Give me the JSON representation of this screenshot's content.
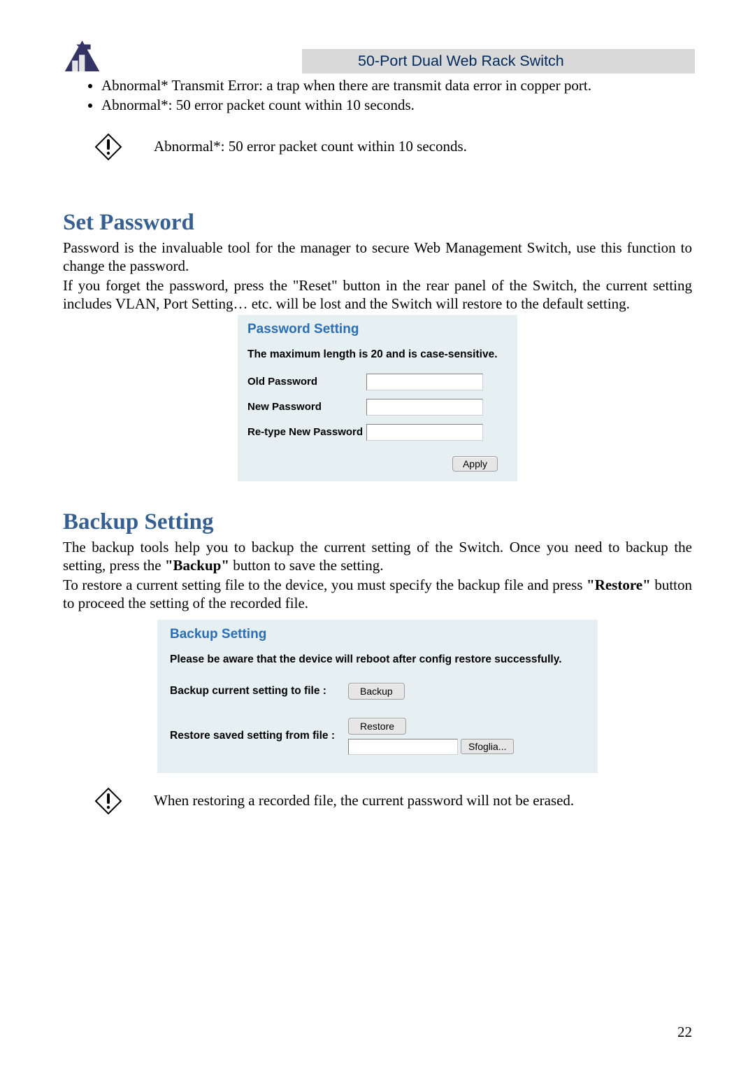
{
  "header": {
    "product_title": "50-Port Dual Web Rack Switch"
  },
  "top_bullets": [
    "Abnormal* Transmit Error: a trap when there are transmit data error in copper port.",
    "Abnormal*: 50 error packet count within 10 seconds."
  ],
  "top_note": "Abnormal*: 50 error packet count within 10 seconds.",
  "set_password": {
    "heading": "Set Password",
    "para1": "Password is the invaluable tool for the manager to secure Web Management Switch, use this function to change the password.",
    "para2": "If you forget the password, press the \"Reset\" button in the rear panel of the Switch, the current setting includes VLAN, Port Setting… etc. will be lost and the Switch will restore to the default setting.",
    "panel_title": "Password Setting",
    "subtitle": "The maximum length is 20 and is case-sensitive.",
    "label_old": "Old Password",
    "label_new": "New Password",
    "label_retype": "Re-type New Password",
    "apply": "Apply"
  },
  "backup": {
    "heading": "Backup Setting",
    "para1_a": "The backup tools help you to backup the current setting of the Switch. Once you need to backup the setting, press the ",
    "para1_b": "\"Backup\"",
    "para1_c": " button to save the setting.",
    "para2_a": "To restore a current setting file to the device, you must specify the backup file and press ",
    "para2_b": "\"Restore\"",
    "para2_c": " button to proceed the setting of the recorded file.",
    "panel_title": "Backup Setting",
    "subtitle": "Please be aware that the device will reboot after config restore successfully.",
    "backup_label": "Backup current setting to file :",
    "backup_btn": "Backup",
    "restore_label": "Restore saved setting from file :",
    "restore_btn": "Restore",
    "browse_btn": "Sfoglia..."
  },
  "bottom_note": "When restoring a recorded file, the current password will not be erased.",
  "page_number": "22"
}
